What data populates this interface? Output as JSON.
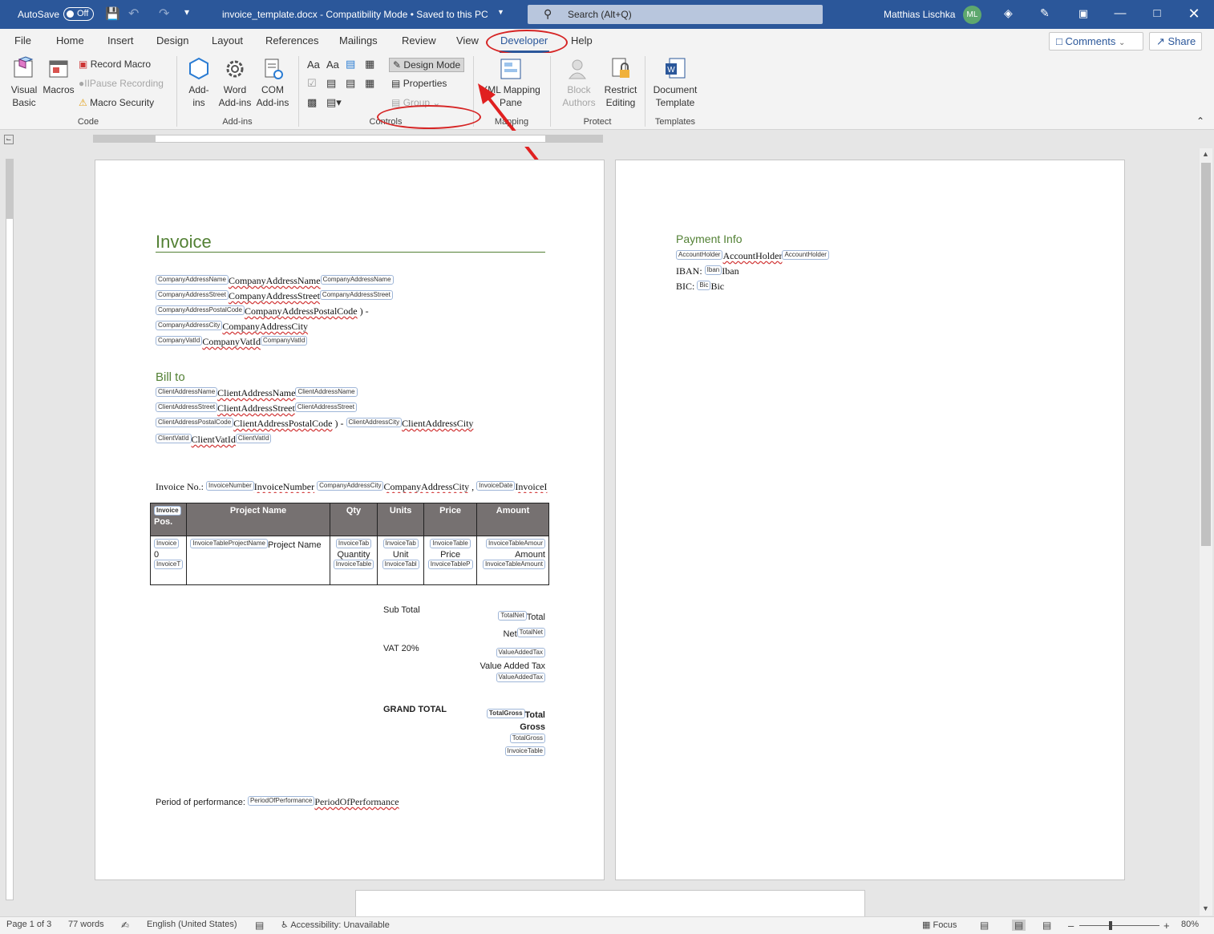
{
  "titlebar": {
    "autosave": "AutoSave",
    "toggle": "Off",
    "doc_title": "invoice_template.docx  -  Compatibility Mode • Saved to this PC",
    "search_placeholder": "Search (Alt+Q)",
    "user": "Matthias Lischka",
    "initials": "ML"
  },
  "tabs": [
    "File",
    "Home",
    "Insert",
    "Design",
    "Layout",
    "References",
    "Mailings",
    "Review",
    "View",
    "Developer",
    "Help"
  ],
  "actions": {
    "comments": "Comments",
    "share": "Share"
  },
  "ribbon": {
    "code": {
      "visual_basic": "Visual Basic",
      "macros": "Macros",
      "record_macro": "Record Macro",
      "pause_recording": "Pause Recording",
      "macro_security": "Macro Security",
      "label": "Code"
    },
    "addins": {
      "addins": "Add-ins",
      "word_addins": "Word Add-ins",
      "com_addins": "COM Add-ins",
      "label": "Add-ins"
    },
    "controls": {
      "design_mode": "Design Mode",
      "properties": "Properties",
      "group": "Group",
      "label": "Controls"
    },
    "mapping": {
      "xml_pane": "XML Mapping Pane",
      "label": "Mapping"
    },
    "protect": {
      "block_authors": "Block Authors",
      "restrict_editing": "Restrict Editing",
      "label": "Protect"
    },
    "templates": {
      "document_template": "Document Template",
      "label": "Templates"
    }
  },
  "page1": {
    "title": "Invoice",
    "company": [
      {
        "tag": "CompanyAddressName",
        "value": "CompanyAddressName"
      },
      {
        "tag": "CompanyAddressStreet",
        "value": "CompanyAddressStreet"
      },
      {
        "tag": "CompanyAddressPostalCode",
        "value": "CompanyAddressPostalCode"
      },
      {
        "tag": "CompanyAddressCity",
        "value": "CompanyAddressCity"
      },
      {
        "tag": "CompanyVatId",
        "value": "CompanyVatId"
      }
    ],
    "bill_to": "Bill to",
    "client": [
      {
        "tag": "ClientAddressName",
        "value": "ClientAddressName"
      },
      {
        "tag": "ClientAddressStreet",
        "value": "ClientAddressStreet"
      },
      {
        "tag": "ClientAddressPostalCode",
        "value": "ClientAddressPostalCode"
      },
      {
        "tag": "ClientAddressCity",
        "value": "ClientAddressCity"
      },
      {
        "tag": "ClientVatId",
        "value": "ClientVatId"
      }
    ],
    "invoice_no_label": "Invoice No.:",
    "invoice_number_tag": "InvoiceNumber",
    "invoice_number": "InvoiceNumber",
    "city_tag": "CompanyAddressCity",
    "city": "CompanyAddressCity",
    "date_tag": "InvoiceDate",
    "date": "InvoiceI",
    "table_headers": [
      "Pos.",
      "Project Name",
      "Qty",
      "Units",
      "Price",
      "Amount"
    ],
    "table_row": {
      "pos_tag": "Invoice",
      "pos": "0",
      "pos_end": "InvoiceT",
      "name_tag": "InvoiceTableProjectName",
      "name": "Project Name",
      "qty_tag": "InvoiceTab",
      "qty": "Quantity",
      "qty_end": "InvoiceTable",
      "unit_tag": "InvoiceTab",
      "unit": "Unit",
      "unit_end": "InvoiceTabl",
      "price_tag": "InvoiceTable",
      "price": "Price",
      "price_end": "InvoiceTableP",
      "amount_tag": "InvoiceTableAmour",
      "amount": "Amount",
      "amount_end": "InvoiceTableAmount"
    },
    "sub_total": "Sub Total",
    "total_net_tag": "TotalNet",
    "total_net": "Total Net",
    "vat": "VAT 20%",
    "vat_tag": "ValueAddedTax",
    "vat_value": "Value Added Tax",
    "grand_total": "GRAND TOTAL",
    "total_gross_tag": "TotalGross",
    "total_gross": "Total Gross",
    "invoice_table_tag": "InvoiceTable",
    "period_label": "Period of performance:",
    "period_tag": "PeriodOfPerformance",
    "period": "PeriodOfPerformance"
  },
  "page2": {
    "title": "Payment Info",
    "holder_tag": "AccountHolder",
    "holder": "AccountHolder",
    "iban_label": "IBAN:",
    "iban_tag": "Iban",
    "iban": "Iban",
    "bic_label": "BIC:",
    "bic_tag": "Bic",
    "bic": "Bic"
  },
  "status": {
    "page": "Page 1 of 3",
    "words": "77 words",
    "language": "English (United States)",
    "accessibility": "Accessibility: Unavailable",
    "focus": "Focus",
    "zoom": "80%"
  },
  "colors": {
    "title_bar": "#2b579a",
    "heading_green": "#538135",
    "annotation_red": "#d62525",
    "table_header": "#767171"
  }
}
